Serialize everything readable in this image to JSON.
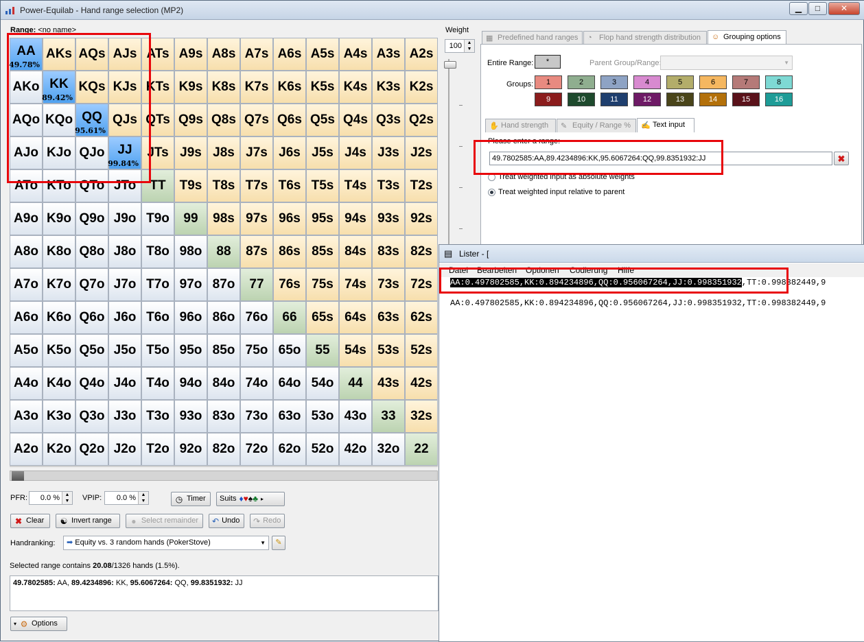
{
  "window": {
    "title": "Power-Equilab - Hand range selection (MP2)",
    "min": "▁",
    "max": "□",
    "close": "✕"
  },
  "range_header": {
    "label": "Range:",
    "value": "<no name>"
  },
  "grid": [
    [
      "AA",
      "AKs",
      "AQs",
      "AJs",
      "ATs",
      "A9s",
      "A8s",
      "A7s",
      "A6s",
      "A5s",
      "A4s",
      "A3s",
      "A2s"
    ],
    [
      "AKo",
      "KK",
      "KQs",
      "KJs",
      "KTs",
      "K9s",
      "K8s",
      "K7s",
      "K6s",
      "K5s",
      "K4s",
      "K3s",
      "K2s"
    ],
    [
      "AQo",
      "KQo",
      "QQ",
      "QJs",
      "QTs",
      "Q9s",
      "Q8s",
      "Q7s",
      "Q6s",
      "Q5s",
      "Q4s",
      "Q3s",
      "Q2s"
    ],
    [
      "AJo",
      "KJo",
      "QJo",
      "JJ",
      "JTs",
      "J9s",
      "J8s",
      "J7s",
      "J6s",
      "J5s",
      "J4s",
      "J3s",
      "J2s"
    ],
    [
      "ATo",
      "KTo",
      "QTo",
      "JTo",
      "TT",
      "T9s",
      "T8s",
      "T7s",
      "T6s",
      "T5s",
      "T4s",
      "T3s",
      "T2s"
    ],
    [
      "A9o",
      "K9o",
      "Q9o",
      "J9o",
      "T9o",
      "99",
      "98s",
      "97s",
      "96s",
      "95s",
      "94s",
      "93s",
      "92s"
    ],
    [
      "A8o",
      "K8o",
      "Q8o",
      "J8o",
      "T8o",
      "98o",
      "88",
      "87s",
      "86s",
      "85s",
      "84s",
      "83s",
      "82s"
    ],
    [
      "A7o",
      "K7o",
      "Q7o",
      "J7o",
      "T7o",
      "97o",
      "87o",
      "77",
      "76s",
      "75s",
      "74s",
      "73s",
      "72s"
    ],
    [
      "A6o",
      "K6o",
      "Q6o",
      "J6o",
      "T6o",
      "96o",
      "86o",
      "76o",
      "66",
      "65s",
      "64s",
      "63s",
      "62s"
    ],
    [
      "A5o",
      "K5o",
      "Q5o",
      "J5o",
      "T5o",
      "95o",
      "85o",
      "75o",
      "65o",
      "55",
      "54s",
      "53s",
      "52s"
    ],
    [
      "A4o",
      "K4o",
      "Q4o",
      "J4o",
      "T4o",
      "94o",
      "84o",
      "74o",
      "64o",
      "54o",
      "44",
      "43s",
      "42s"
    ],
    [
      "A3o",
      "K3o",
      "Q3o",
      "J3o",
      "T3o",
      "93o",
      "83o",
      "73o",
      "63o",
      "53o",
      "43o",
      "33",
      "32s"
    ],
    [
      "A2o",
      "K2o",
      "Q2o",
      "J2o",
      "T2o",
      "92o",
      "82o",
      "72o",
      "62o",
      "52o",
      "42o",
      "32o",
      "22"
    ]
  ],
  "selected": {
    "AA": "49.78%",
    "KK": "89.42%",
    "QQ": "95.61%",
    "JJ": "99.84%"
  },
  "controls": {
    "pfr_label": "PFR:",
    "pfr_value": "0.0 %",
    "vpip_label": "VPIP:",
    "vpip_value": "0.0 %",
    "timer": "Timer",
    "suits": "Suits",
    "clear": "Clear",
    "invert": "Invert range",
    "select_remainder": "Select remainder",
    "undo": "Undo",
    "redo": "Redo",
    "handranking_label": "Handranking:",
    "handranking_value": "Equity vs. 3 random hands (PokerStove)",
    "options": "Options"
  },
  "summary": {
    "prefix": "Selected range contains ",
    "count": "20.08",
    "suffix": "/1326 hands (1.5%)."
  },
  "range_text": [
    {
      "w": "49.7802585:",
      "h": " AA, "
    },
    {
      "w": "89.4234896:",
      "h": " KK, "
    },
    {
      "w": "95.6067264:",
      "h": " QQ, "
    },
    {
      "w": "99.8351932:",
      "h": " JJ"
    }
  ],
  "weight": {
    "label": "Weight",
    "value": "100"
  },
  "tabs": [
    "Predefined hand ranges",
    "Flop hand strength distribution",
    "Grouping options"
  ],
  "grouping": {
    "entire_range": "Entire Range:",
    "entire_btn": "*",
    "parent_label": "Parent Group/Range:",
    "groups_label": "Groups:",
    "groups": [
      "1",
      "2",
      "3",
      "4",
      "5",
      "6",
      "7",
      "8",
      "9",
      "10",
      "11",
      "12",
      "13",
      "14",
      "15",
      "16"
    ],
    "group_colors": [
      "#e88a80",
      "#8fae8f",
      "#8ea3c4",
      "#d88ad0",
      "#b3ad6a",
      "#f5b760",
      "#b57a78",
      "#7ed9d4",
      "#8b1c1c",
      "#1e4a2d",
      "#1f3f6e",
      "#6e1a66",
      "#4a451a",
      "#b3700a",
      "#5a121a",
      "#1e9c97"
    ]
  },
  "subtabs": [
    "Hand strength",
    "Equity / Range %",
    "Text input"
  ],
  "textinput": {
    "prompt": "Please enter a range:",
    "value": "49.7802585:AA,89.4234896:KK,95.6067264:QQ,99.8351932:JJ",
    "radio1": "Treat weighted input as absolute weights",
    "radio2": "Treat weighted input relative to parent"
  },
  "lister": {
    "title": "Lister - [",
    "menu": [
      "Datei",
      "Bearbeiten",
      "Optionen",
      "Codierung",
      "Hilfe"
    ],
    "line1_sel": "AA:0.497802585,KK:0.894234896,QQ:0.956067264,JJ:0.998351932",
    "line1_rest": ",TT:0.998382449,9",
    "line2": "AA:0.497802585,KK:0.894234896,QQ:0.956067264,JJ:0.998351932,TT:0.998382449,9"
  }
}
